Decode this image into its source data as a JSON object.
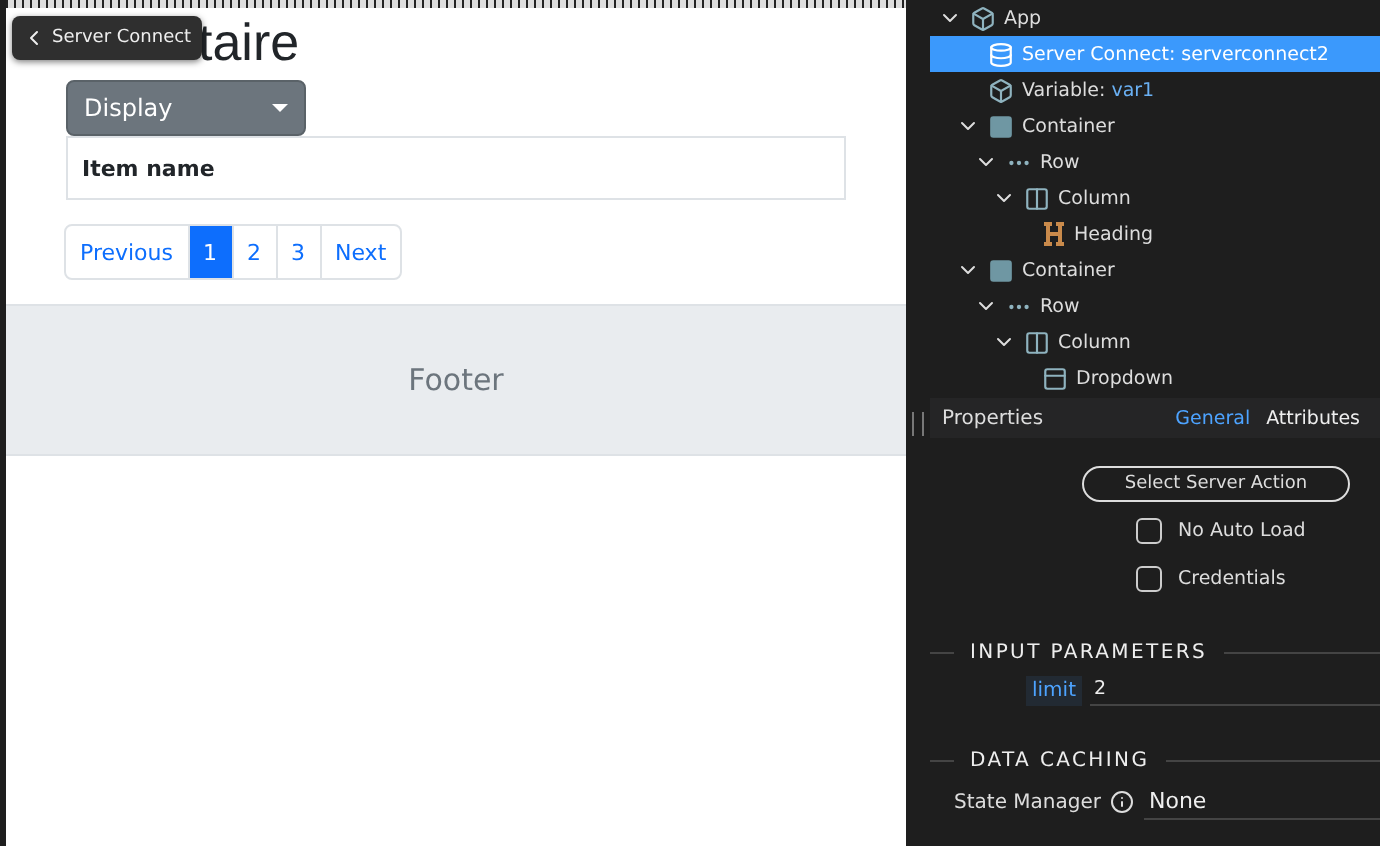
{
  "canvas": {
    "tooltip": "Server Connect",
    "heading": "taire",
    "dropdown": {
      "label": "Display"
    },
    "table": {
      "columns": [
        "Item name"
      ]
    },
    "pagination": [
      {
        "label": "Previous",
        "selected": false
      },
      {
        "label": "1",
        "selected": true
      },
      {
        "label": "2",
        "selected": false
      },
      {
        "label": "3",
        "selected": false
      },
      {
        "label": "Next",
        "selected": false
      }
    ],
    "footer": "Footer"
  },
  "tree": [
    {
      "kind": "app",
      "label": "App",
      "expanded": true,
      "selected": false,
      "children": [
        {
          "kind": "server-connect",
          "label": "Server Connect: serverconnect2",
          "selected": true
        },
        {
          "kind": "variable",
          "label": "Variable:",
          "value": "var1",
          "selected": false
        },
        {
          "kind": "container",
          "label": "Container",
          "expanded": true,
          "selected": false,
          "children": [
            {
              "kind": "row",
              "label": "Row",
              "expanded": true,
              "selected": false,
              "children": [
                {
                  "kind": "column",
                  "label": "Column",
                  "expanded": true,
                  "selected": false,
                  "children": [
                    {
                      "kind": "heading",
                      "label": "Heading",
                      "selected": false
                    }
                  ]
                }
              ]
            }
          ]
        },
        {
          "kind": "container",
          "label": "Container",
          "expanded": true,
          "selected": false,
          "children": [
            {
              "kind": "row",
              "label": "Row",
              "expanded": true,
              "selected": false,
              "children": [
                {
                  "kind": "column",
                  "label": "Column",
                  "expanded": true,
                  "selected": false,
                  "children": [
                    {
                      "kind": "dropdown",
                      "label": "Dropdown",
                      "selected": false
                    }
                  ]
                }
              ]
            }
          ]
        }
      ]
    }
  ],
  "properties": {
    "title": "Properties",
    "tabs": [
      {
        "label": "General",
        "selected": true
      },
      {
        "label": "Attributes",
        "selected": false
      }
    ],
    "action_button": "Select Server Action",
    "checkboxes": [
      {
        "label": "No Auto Load",
        "checked": false
      },
      {
        "label": "Credentials",
        "checked": false
      }
    ],
    "input_parameters": {
      "title": "INPUT PARAMETERS",
      "params": [
        {
          "name": "limit",
          "value": "2"
        }
      ]
    },
    "data_caching": {
      "title": "DATA CACHING",
      "fields": [
        {
          "label": "State Manager",
          "value": "None"
        }
      ]
    }
  }
}
